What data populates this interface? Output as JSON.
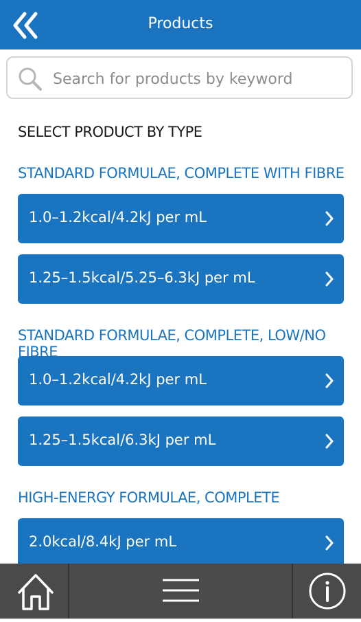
{
  "header": {
    "title": "Products",
    "back_icon": "double-chevron-left-icon"
  },
  "search": {
    "placeholder": "Search for products by keyword",
    "icon": "search-icon"
  },
  "select_title": "SELECT PRODUCT BY TYPE",
  "sections": [
    {
      "title": "STANDARD FORMULAE, COMPLETE WITH FIBRE",
      "items": [
        "1.0–1.2kcal/4.2kJ per mL",
        "1.25–1.5kcal/5.25–6.3kJ per mL"
      ]
    },
    {
      "title": "STANDARD FORMULAE, COMPLETE, LOW/NO FIBRE",
      "items": [
        "1.0–1.2kcal/4.2kJ per mL",
        "1.25–1.5kcal/6.3kJ per mL"
      ]
    },
    {
      "title": "HIGH-ENERGY FORMULAE, COMPLETE",
      "items": [
        "2.0kcal/8.4kJ per mL"
      ]
    }
  ],
  "footer": {
    "home_icon": "home-icon",
    "menu_icon": "hamburger-menu-icon",
    "info_icon": "info-icon"
  },
  "colors": {
    "brand": "#1a74bf",
    "footer": "#4a4a4a",
    "text": "#1a1a1a"
  }
}
